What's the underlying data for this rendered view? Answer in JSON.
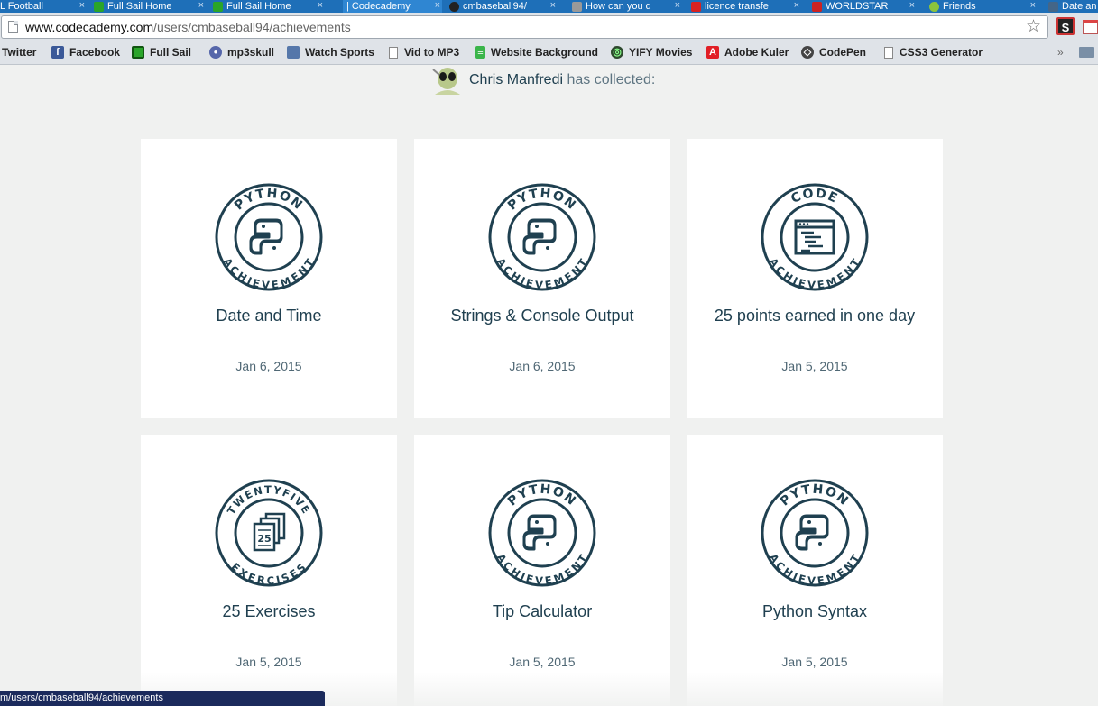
{
  "browser": {
    "tabs": [
      {
        "title": "L Football",
        "favicon_color": "#3c7a3c",
        "active": false
      },
      {
        "title": "Full Sail Home",
        "favicon_color": "#2aa52a",
        "active": false
      },
      {
        "title": "Full Sail Home",
        "favicon_color": "#2aa52a",
        "active": false
      },
      {
        "title": "| Codecademy",
        "favicon_color": "",
        "active": true
      },
      {
        "title": "cmbaseball94/",
        "favicon_color": "#222222",
        "active": false
      },
      {
        "title": "How can you d",
        "favicon_color": "#888888",
        "active": false
      },
      {
        "title": "licence transfe",
        "favicon_color": "#d82222",
        "active": false
      },
      {
        "title": "WORLDSTAR",
        "favicon_color": "#cc2222",
        "active": false
      },
      {
        "title": "Friends",
        "favicon_color": "#8cc43c",
        "active": false
      },
      {
        "title": "Date an",
        "favicon_color": "#446688",
        "active": false
      }
    ],
    "tab_close_glyph": "×",
    "url_host": "www.codecademy.com",
    "url_path": "/users/cmbaseball94/achievements",
    "bookmarks": [
      {
        "label": "Twitter",
        "icon": "none"
      },
      {
        "label": "Facebook",
        "icon": "facebook-icon",
        "color": "#3b5998",
        "glyph": "f"
      },
      {
        "label": "Full Sail",
        "icon": "full-sail-icon",
        "color": "#2aa52a",
        "glyph": ""
      },
      {
        "label": "mp3skull",
        "icon": "alien-icon",
        "color": "#5566aa",
        "glyph": "●"
      },
      {
        "label": "Watch Sports",
        "icon": "tv-icon",
        "color": "#5577aa",
        "glyph": ""
      },
      {
        "label": "Vid to MP3",
        "icon": "doc"
      },
      {
        "label": "Website Background",
        "icon": "bg-icon",
        "color": "#3ab54a",
        "glyph": "≡"
      },
      {
        "label": "YIFY Movies",
        "icon": "yify-icon",
        "color": "#2e4a2e",
        "glyph": "◎"
      },
      {
        "label": "Adobe Kuler",
        "icon": "adobe-icon",
        "color": "#e11f26",
        "glyph": "A"
      },
      {
        "label": "CodePen",
        "icon": "codepen-icon",
        "color": "#444444",
        "glyph": "◇"
      },
      {
        "label": "CSS3 Generator",
        "icon": "doc"
      }
    ],
    "bookmarks_overflow": "»",
    "status_url": "m/users/cmbaseball94/achievements"
  },
  "profile": {
    "user_name": "Chris Manfredi",
    "collected_suffix": " has collected:"
  },
  "achievements": [
    {
      "badge_type": "python",
      "badge_top": "PYTHON",
      "badge_bottom": "ACHIEVEMENT",
      "title": "Date and Time",
      "date": "Jan 6, 2015"
    },
    {
      "badge_type": "python",
      "badge_top": "PYTHON",
      "badge_bottom": "ACHIEVEMENT",
      "title": "Strings & Console Output",
      "date": "Jan 6, 2015"
    },
    {
      "badge_type": "code",
      "badge_top": "CODE",
      "badge_bottom": "ACHIEVEMENT",
      "title": "25 points earned in one day",
      "date": "Jan 5, 2015"
    },
    {
      "badge_type": "exercises",
      "badge_top": "TWENTYFIVE",
      "badge_bottom": "EXERCISES",
      "badge_number": "25",
      "title": "25 Exercises",
      "date": "Jan 5, 2015"
    },
    {
      "badge_type": "python",
      "badge_top": "PYTHON",
      "badge_bottom": "ACHIEVEMENT",
      "title": "Tip Calculator",
      "date": "Jan 5, 2015"
    },
    {
      "badge_type": "python",
      "badge_top": "PYTHON",
      "badge_bottom": "ACHIEVEMENT",
      "title": "Python Syntax",
      "date": "Jan 5, 2015"
    }
  ],
  "colors": {
    "badge_ink": "#1f4050",
    "page_background": "#f0f1f0",
    "tab_strip": "#1e6fb8"
  }
}
